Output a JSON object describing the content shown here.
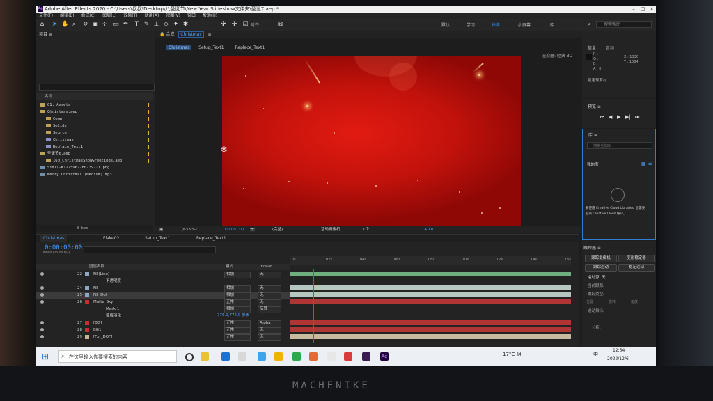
{
  "title_bar": {
    "text": "Adobe After Effects 2020 - C:\\Users\\叔叔\\Desktop\\八圣诞节\\New Year Slideshow文件夹\\圣诞7.aep *"
  },
  "menu": [
    "文件(F)",
    "编辑(E)",
    "合成(C)",
    "图层(L)",
    "效果(T)",
    "动画(A)",
    "视图(V)",
    "窗口",
    "帮助(H)"
  ],
  "toolbar": {
    "align_label": "对齐"
  },
  "workspaces": [
    "默认",
    "学习",
    "标准",
    "小屏幕",
    "库"
  ],
  "active_workspace": "标准",
  "search_help": "搜索帮助",
  "project": {
    "title": "项目 ≡",
    "column_name": "名称",
    "items": [
      {
        "name": "01. Assets",
        "type": "folder"
      },
      {
        "name": "Christmas.aep",
        "type": "folder"
      },
      {
        "name": "Comp",
        "type": "folder"
      },
      {
        "name": "Solids",
        "type": "folder"
      },
      {
        "name": "Source",
        "type": "folder"
      },
      {
        "name": "Christmas",
        "type": "comp"
      },
      {
        "name": "Replace_Text1",
        "type": "comp"
      },
      {
        "name": "圣诞节6.aep",
        "type": "folder"
      },
      {
        "name": "160_ChristmasSnowGreetings.aep",
        "type": "folder"
      },
      {
        "name": "Simlz-K1225962-B0239221.png",
        "type": "file"
      },
      {
        "name": "Merry Christmas (Medium).mp3",
        "type": "file"
      }
    ],
    "bpc": "8 bpc"
  },
  "composition": {
    "panel_label": "合成",
    "comp_tab": "Christmas",
    "breadcrumbs": [
      "Christmas",
      "Setup_Text1",
      "Replace_Text1"
    ],
    "renderer_label": "渲染器: 经典 3D",
    "zoom": "(63.9%)",
    "timecode": "0:00:01:07",
    "resolution": "(完整)",
    "camera": "活动摄像机",
    "views": "1个...",
    "exposure": "+0.0"
  },
  "info_panel": {
    "tabs": [
      "信息",
      "音频"
    ],
    "r": "R :",
    "g": "G :",
    "b": "B :",
    "a": "A : 0",
    "x": "X : 1136",
    "y": "Y : 1084",
    "note": "锁定现有材"
  },
  "preview": {
    "title": "预览 ≡"
  },
  "library": {
    "title": "库 ≡",
    "search_placeholder": "搜索当前库",
    "dropdown": "我的库",
    "message_line1": "要使用 Creative Cloud Libraries, 您需要",
    "message_line2": "登录 Creative Cloud 帐户。"
  },
  "tracker": {
    "title": "跟踪器 ≡",
    "buttons": [
      "跟踪摄像机",
      "变形稳定器",
      "跟踪运动",
      "稳定运动"
    ],
    "motion_source": "运动源: 无",
    "current_track": "当前跟踪:",
    "track_type": "跟踪类型:",
    "options": [
      "位置",
      "旋转",
      "缩放"
    ],
    "motion_target": "运动目标:",
    "analyze": "分析:"
  },
  "timeline": {
    "tabs": [
      "Christmas",
      "Flake02",
      "Setup_Text1",
      "Replace_Text1"
    ],
    "time": "0:00:00:00",
    "fps": "00000 (25.00 fps)",
    "columns": {
      "name": "图层名称",
      "mode": "模式",
      "t": "T",
      "trkmat": "TrkMat"
    },
    "ruler": [
      "0s",
      "02s",
      "04s",
      "06s",
      "08s",
      "10s",
      "12s",
      "14s",
      "16s"
    ],
    "layers": [
      {
        "num": "22",
        "name": "Fill(Line)",
        "mode": "相加",
        "trk": "无",
        "color": "#8aa8c8",
        "bar": "#6fae7e"
      },
      {
        "num": "",
        "name": "不透明度",
        "mode": "",
        "trk": "",
        "color": "",
        "bar": ""
      },
      {
        "num": "24",
        "name": "Fill",
        "mode": "相加",
        "trk": "无",
        "color": "#8aa8c8",
        "bar": "#b7c7c0"
      },
      {
        "num": "25",
        "name": "Fill_Dot",
        "mode": "相加",
        "trk": "无",
        "color": "#8aa8c8",
        "bar": "#b7c7c0"
      },
      {
        "num": "26",
        "name": "Matte_Sky",
        "mode": "正常",
        "trk": "无",
        "color": "#c23030",
        "bar": "#b23535"
      },
      {
        "num": "",
        "name": "Mask 1",
        "mode": "相加",
        "trk": "反转",
        "color": "",
        "bar": ""
      },
      {
        "num": "",
        "name": "蒙版羽化",
        "mode": "776.0,776.0 像素",
        "trk": "",
        "color": "",
        "bar": ""
      },
      {
        "num": "27",
        "name": "[BG]",
        "mode": "正常",
        "trk": "Alpha",
        "color": "#c23030",
        "bar": "#b23535"
      },
      {
        "num": "28",
        "name": "BG1",
        "mode": "正常",
        "trk": "无",
        "color": "#c23030",
        "bar": "#b23535"
      },
      {
        "num": "29",
        "name": "[For_DOF]",
        "mode": "正常",
        "trk": "无",
        "color": "#c7b58c",
        "bar": "#c9bba0"
      }
    ]
  },
  "taskbar": {
    "search_placeholder": "在这里输入你要搜索的内容",
    "weather": "17°C 阴",
    "ime": "中",
    "time": "12:54",
    "date": "2022/12/6"
  },
  "brand": "MACHENIKE"
}
